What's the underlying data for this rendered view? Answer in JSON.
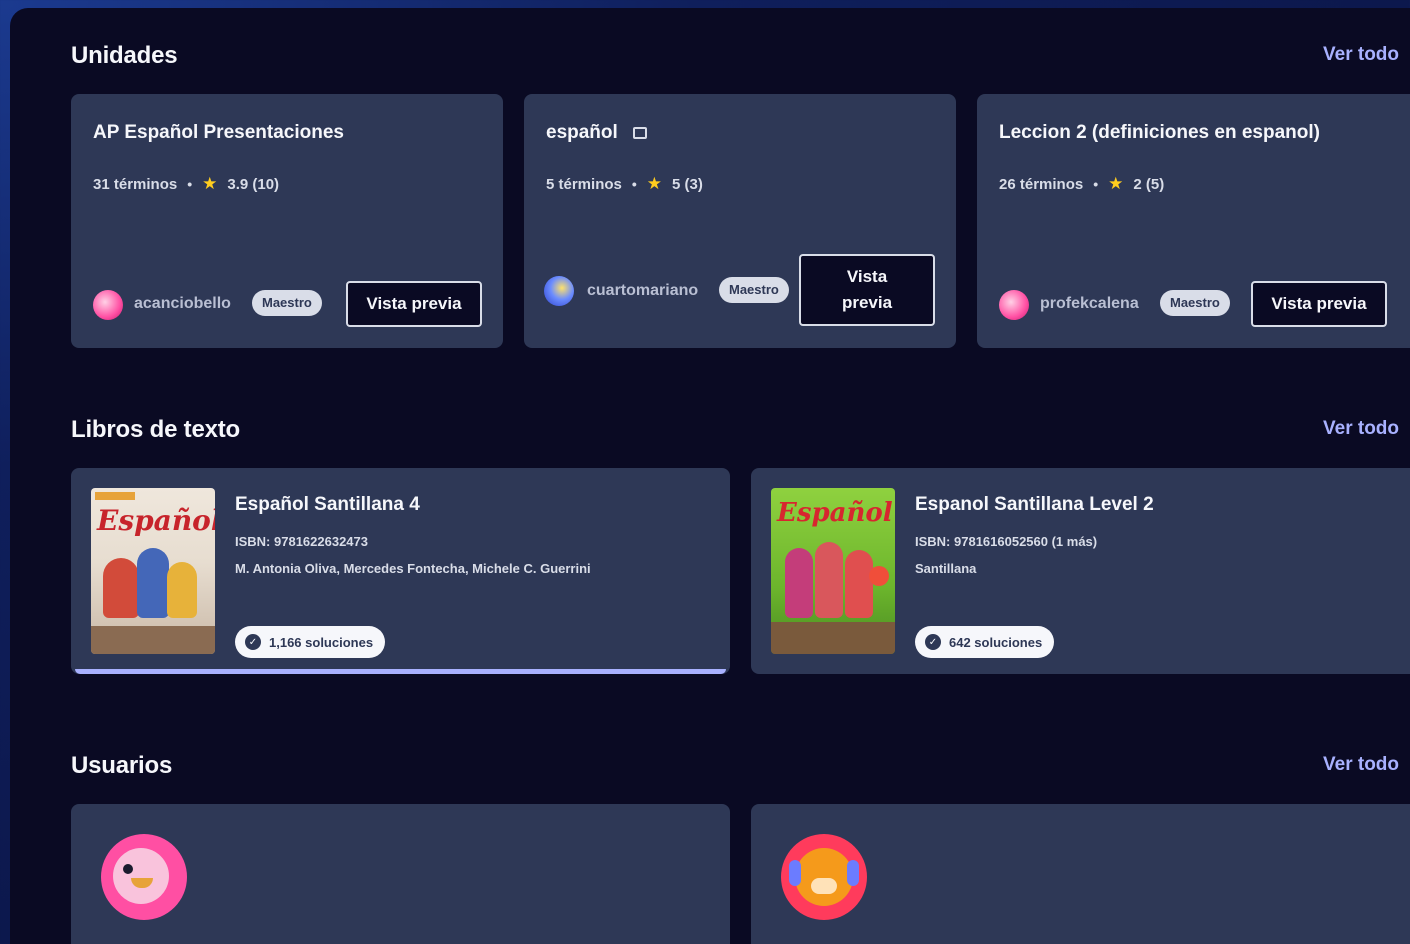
{
  "units": {
    "title": "Unidades",
    "see_all": "Ver todo",
    "cards": [
      {
        "title": "AP Español Presentaciones",
        "terms": "31 términos",
        "rating": "3.9 (10)",
        "user": "acanciobello",
        "role": "Maestro",
        "preview": "Vista previa"
      },
      {
        "title": "español",
        "terms": "5 términos",
        "rating": "5 (3)",
        "user": "cuartomariano",
        "role": "Maestro",
        "preview": "Vista previa"
      },
      {
        "title": "Leccion 2 (definiciones en espanol)",
        "terms": "26 términos",
        "rating": "2 (5)",
        "user": "profekcalena",
        "role": "Maestro",
        "preview": "Vista previa"
      }
    ]
  },
  "textbooks": {
    "title": "Libros de texto",
    "see_all": "Ver todo",
    "cards": [
      {
        "title": "Español Santillana 4",
        "isbn": "ISBN: 9781622632473",
        "authors": "M. Antonia Oliva, Mercedes Fontecha, Michele C. Guerrini",
        "solutions": "1,166 soluciones",
        "cover_text": "Español",
        "cover_color": "#e9e2d8"
      },
      {
        "title": "Espanol Santillana Level 2",
        "isbn": "ISBN: 9781616052560 (1 más)",
        "publisher": "Santillana",
        "solutions": "642 soluciones",
        "cover_text": "Español",
        "cover_color": "#7fc43a"
      }
    ]
  },
  "users": {
    "title": "Usuarios",
    "see_all": "Ver todo"
  },
  "colors": {
    "accent": "#a8b1ff",
    "card": "#2e3856",
    "panel": "#0a0a23",
    "star": "#ffcd1f"
  }
}
